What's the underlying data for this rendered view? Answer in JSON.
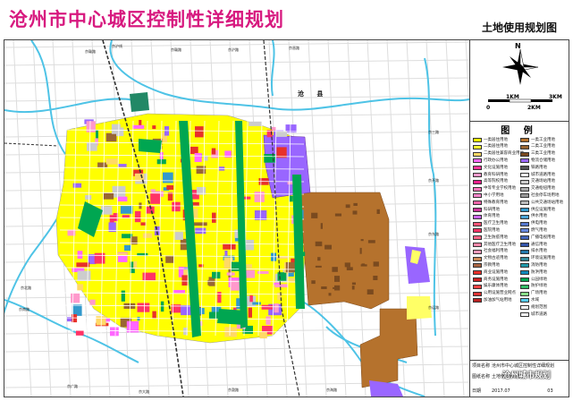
{
  "header": {
    "title": "沧州市中心城区控制性详细规划",
    "subtitle": "土地使用规划图"
  },
  "compass": {
    "north": "N",
    "scale_labels": [
      "0",
      "1KM",
      "2KM",
      "3KM"
    ]
  },
  "legend": {
    "title": "图 例",
    "left_items": [
      {
        "label": "一类居住用地",
        "color": "#ffff00"
      },
      {
        "label": "二类居住用地",
        "color": "#ffff33"
      },
      {
        "label": "二类居住兼容商业用地",
        "color": "#ffd966"
      },
      {
        "label": "行政办公用地",
        "color": "#ff66ff"
      },
      {
        "label": "文化设施用地",
        "color": "#ff3399"
      },
      {
        "label": "教育科研用地",
        "color": "#ff99cc"
      },
      {
        "label": "高等院校用地",
        "color": "#e91e8c"
      },
      {
        "label": "中等专业学校用地",
        "color": "#ff77bb"
      },
      {
        "label": "中小学用地",
        "color": "#ff88cc"
      },
      {
        "label": "特殊教育用地",
        "color": "#ee66aa"
      },
      {
        "label": "科研用地",
        "color": "#cc3399"
      },
      {
        "label": "体育用地",
        "color": "#cc66ff"
      },
      {
        "label": "医疗卫生用地",
        "color": "#ff5577"
      },
      {
        "label": "医院用地",
        "color": "#ff3366"
      },
      {
        "label": "卫生防疫用地",
        "color": "#ff6688"
      },
      {
        "label": "其他医疗卫生用地",
        "color": "#ff88aa"
      },
      {
        "label": "社会福利用地",
        "color": "#ff99bb"
      },
      {
        "label": "文物古迹用地",
        "color": "#cc8855"
      },
      {
        "label": "宗教用地",
        "color": "#aa6644"
      },
      {
        "label": "商业设施用地",
        "color": "#e8312a"
      },
      {
        "label": "商务设施用地",
        "color": "#cc2222"
      },
      {
        "label": "娱乐康体用地",
        "color": "#ff4444"
      },
      {
        "label": "公用设施营业网点",
        "color": "#dd3333"
      },
      {
        "label": "加油加气站用地",
        "color": "#bb2222"
      }
    ],
    "right_items": [
      {
        "label": "一类工业用地",
        "color": "#b5722d"
      },
      {
        "label": "二类工业用地",
        "color": "#996633"
      },
      {
        "label": "三类工业用地",
        "color": "#7a4a1f"
      },
      {
        "label": "物流仓储用地",
        "color": "#9966ff"
      },
      {
        "label": "铁路用地",
        "color": "#555555"
      },
      {
        "label": "城市道路用地",
        "color": "#ffffff"
      },
      {
        "label": "交通场站用地",
        "color": "#cccccc"
      },
      {
        "label": "交通枢纽用地",
        "color": "#aaaaaa"
      },
      {
        "label": "社会停车场用地",
        "color": "#999999"
      },
      {
        "label": "公共交通场站用地",
        "color": "#bbbbbb"
      },
      {
        "label": "供应设施用地",
        "color": "#3399cc"
      },
      {
        "label": "供水用地",
        "color": "#4aa3d6"
      },
      {
        "label": "供电用地",
        "color": "#5577cc"
      },
      {
        "label": "燃气用地",
        "color": "#6688dd"
      },
      {
        "label": "广播电视用地",
        "color": "#4466bb"
      },
      {
        "label": "通信用地",
        "color": "#3355aa"
      },
      {
        "label": "排水用地",
        "color": "#2277aa"
      },
      {
        "label": "环境设施用地",
        "color": "#338899"
      },
      {
        "label": "消防用地",
        "color": "#2299aa"
      },
      {
        "label": "防洪用地",
        "color": "#1188bb"
      },
      {
        "label": "公园绿地",
        "color": "#00a651"
      },
      {
        "label": "防护绿地",
        "color": "#33bb66"
      },
      {
        "label": "广场用地",
        "color": "#88dd88"
      },
      {
        "label": "水域",
        "color": "#55ccee"
      },
      {
        "label": "规划范围",
        "color": "#ffffff"
      },
      {
        "label": "城市道路",
        "color": "#ffffff"
      }
    ]
  },
  "titleblock": {
    "rows": [
      {
        "key": "项目名称",
        "value": "沧州市中心城区控制性详细规划"
      },
      {
        "key": "图纸名称",
        "value": "土地使用规划图"
      },
      {
        "key": "日期",
        "value": "2017.07"
      }
    ],
    "page": "03",
    "watermark": "沧州城市规划"
  },
  "map": {
    "river_label": "沧 县",
    "road_labels": [
      "京沪线",
      "京赣路",
      "京赣路",
      "京沪路",
      "京晋路",
      "京三路",
      "京开路",
      "京东路",
      "京北路",
      "京南路",
      "京广路",
      "京大路",
      "京渤路",
      "京海路",
      "京运路"
    ]
  },
  "colors": {
    "title": "#d7197f",
    "residential": "#ffff00",
    "industrial": "#b5722d",
    "logistics": "#9966ff",
    "green": "#00a651",
    "commercial": "#e8312a",
    "water": "#55ccee",
    "education": "#ff99cc"
  }
}
